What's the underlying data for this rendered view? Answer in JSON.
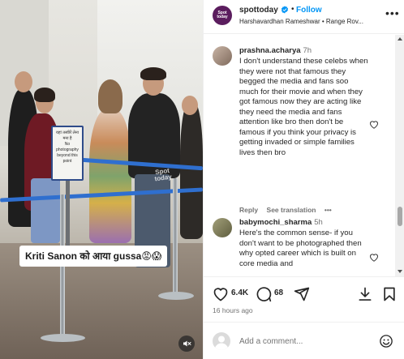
{
  "media": {
    "caption_overlay": "Kriti Sanon को आया gussa😡😱",
    "watermark_line1": "Spot",
    "watermark_line2": "today",
    "sign_text": "यहां तस्वीरें लेना मना है\nNo photography\nbeyond this point",
    "mute_icon": "muted-speaker-icon"
  },
  "header": {
    "avatar_text": "Spot today",
    "username": "spottoday",
    "follow_label": "Follow",
    "subtitle": "Harshavardhan Rameshwar • Range Rov...",
    "more_icon": "more-options-icon"
  },
  "comments": [
    {
      "username": "prashna.acharya",
      "time": "7h",
      "text": "I don't understand these celebs when they were not that famous they begged the media and fans soo much for their movie and when they got famous now they are acting like they need the media and fans attention like bro then don't be famous if you think your privacy is getting invaded or simple families lives then bro",
      "reply_label": "Reply",
      "see_translation_label": "See translation",
      "more_label": "•••"
    },
    {
      "username": "babymochi_sharma",
      "time": "5h",
      "text": "Here's the common sense- if you don't want to be photographed then why opted career which is built on core media and"
    }
  ],
  "actions": {
    "likes": "6.4K",
    "comments": "68",
    "time_ago": "16 hours ago"
  },
  "add_comment": {
    "placeholder": "Add a comment..."
  },
  "colors": {
    "accent": "#0095f6",
    "brand_avatar": "#5b1d5e",
    "text": "#262626",
    "muted": "#737373"
  }
}
